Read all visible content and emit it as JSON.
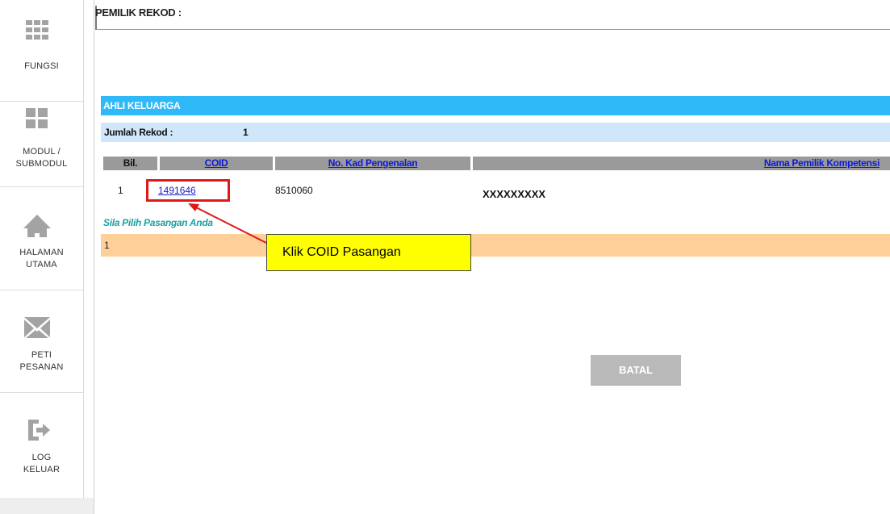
{
  "sidebar": {
    "items": [
      {
        "label_1": "FUNGSI",
        "label_2": "",
        "icon": "grid-icon"
      },
      {
        "label_1": "MODUL /",
        "label_2": "SUBMODUL",
        "icon": "tiles-icon"
      },
      {
        "label_1": "HALAMAN",
        "label_2": "UTAMA",
        "icon": "home-icon"
      },
      {
        "label_1": "PETI",
        "label_2": "PESANAN",
        "icon": "mail-icon"
      },
      {
        "label_1": "LOG",
        "label_2": "KELUAR",
        "icon": "logout-icon"
      }
    ],
    "icon_color": "#a3a3a3"
  },
  "owner": {
    "label": "PEMILIK REKOD :"
  },
  "section": {
    "title": "AHLI KELUARGA",
    "count_label": "Jumlah Rekod :",
    "count_value": "1"
  },
  "table": {
    "headers": {
      "bil": "Bil.",
      "coid": "COID",
      "ic": "No. Kad Pengenalan",
      "name": "Nama Pemilik Kompetensi"
    },
    "rows": [
      {
        "bil": "1",
        "coid": "1491646",
        "ic": "8510060",
        "name": "XXXXXXXXX"
      }
    ]
  },
  "pick": {
    "label": "Sila Pilih Pasangan Anda",
    "row_value": "1"
  },
  "annotation": {
    "callout": "Klik COID Pasangan",
    "box_color": "#e01818",
    "callout_color": "#ffff00"
  },
  "buttons": {
    "batal": "BATAL"
  },
  "colors": {
    "header_blue": "#2fb9f8",
    "count_row": "#cfe6fb",
    "table_header": "#9a9a9a",
    "peach": "#ffcf9a"
  }
}
